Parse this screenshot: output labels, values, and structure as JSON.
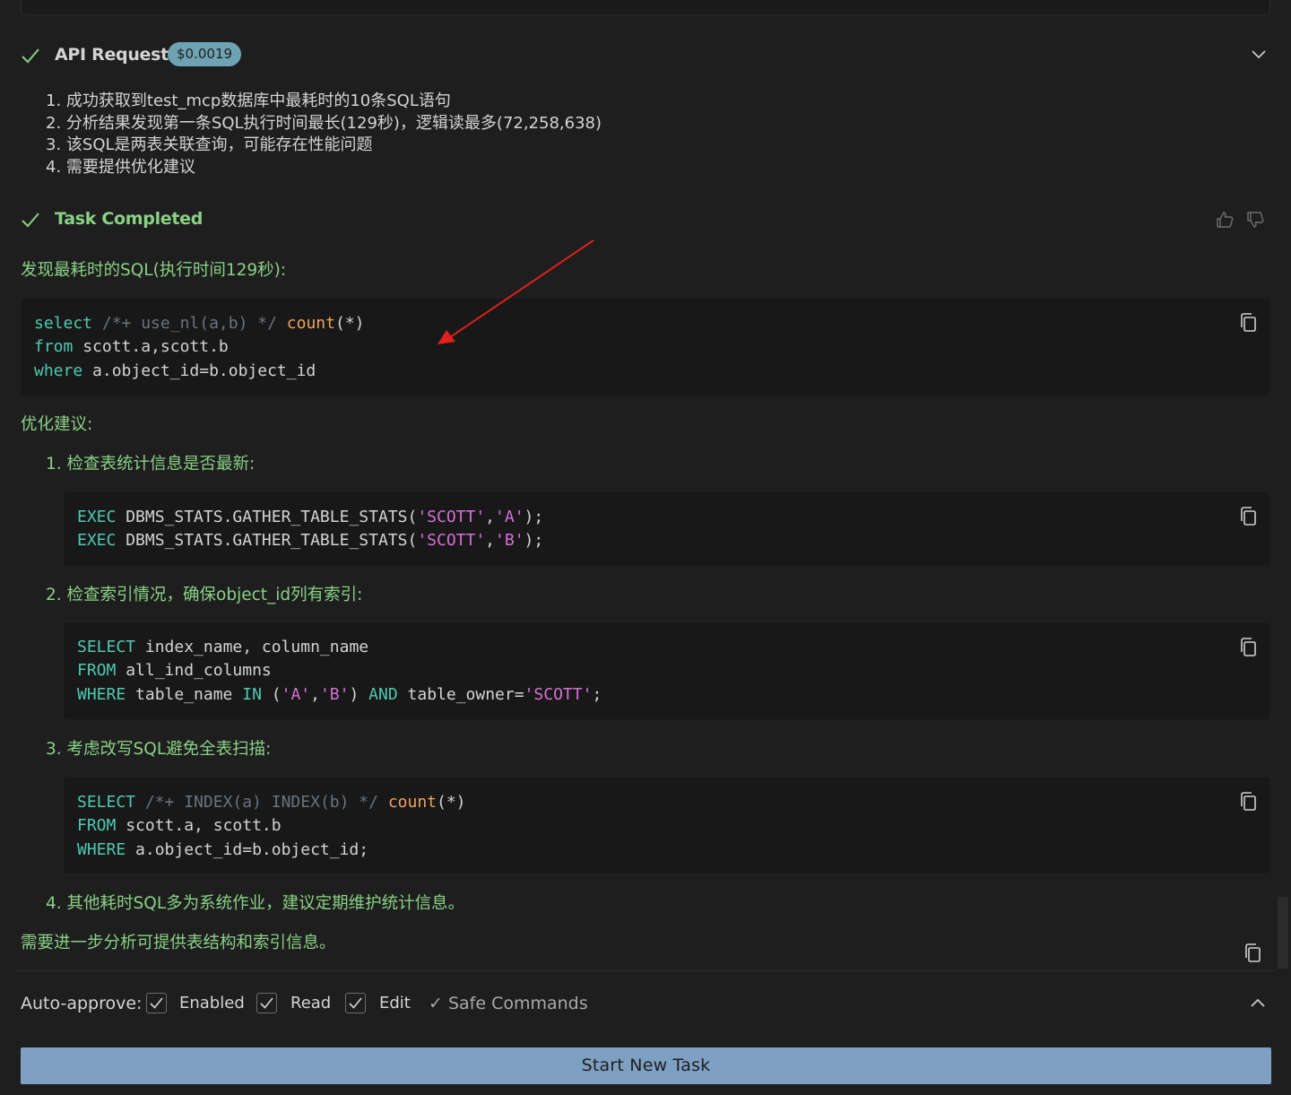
{
  "api_request": {
    "title": "API Request",
    "cost": "$0.0019",
    "items": [
      "1. 成功获取到test_mcp数据库中最耗时的10条SQL语句",
      "2. 分析结果发现第一条SQL执行时间最长(129秒)，逻辑读最多(72,258,638)",
      "3. 该SQL是两表关联查询，可能存在性能问题",
      "4. 需要提供优化建议"
    ]
  },
  "task": {
    "title": "Task Completed",
    "finding": "发现最耗时的SQL(执行时间129秒):",
    "code1": {
      "l1_kw": "select",
      "l1_cm": "/*+ use_nl(a,b) */",
      "l1_fn": "count",
      "l1_rest": "(*)",
      "l2_kw": "from",
      "l2_rest": " scott.a,scott.b",
      "l3_kw": "where",
      "l3_rest": " a.object_id=b.object_id"
    },
    "suggest_title": "优化建议:",
    "steps": [
      "1. 检查表统计信息是否最新:",
      "2. 检查索引情况，确保object_id列有索引:",
      "3. 考虑改写SQL避免全表扫描:",
      "4. 其他耗时SQL多为系统作业，建议定期维护统计信息。"
    ],
    "code2": {
      "kw": "EXEC",
      "call": " DBMS_STATS.GATHER_TABLE_STATS(",
      "s1": "'SCOTT'",
      "comma": ",",
      "sA": "'A'",
      "sB": "'B'",
      "end": ");"
    },
    "code3": {
      "l1_kw": "SELECT",
      "l1_rest": " index_name, column_name",
      "l2_kw": "FROM",
      "l2_rest": " all_ind_columns",
      "l3_kw": "WHERE",
      "l3_a": " table_name ",
      "l3_in": "IN",
      "l3_b": " (",
      "l3_sA": "'A'",
      "l3_c": ",",
      "l3_sB": "'B'",
      "l3_d": ") ",
      "l3_and": "AND",
      "l3_e": " table_owner=",
      "l3_sS": "'SCOTT'",
      "l3_f": ";"
    },
    "code4": {
      "l1_kw": "SELECT",
      "l1_cm": "/*+ INDEX(a) INDEX(b) */",
      "l1_fn": "count",
      "l1_rest": "(*)",
      "l2_kw": "FROM",
      "l2_rest": " scott.a, scott.b",
      "l3_kw": "WHERE",
      "l3_rest": " a.object_id=b.object_id;"
    },
    "footer_note": "需要进一步分析可提供表结构和索引信息。"
  },
  "auto_approve": {
    "label": "Auto-approve:",
    "options": [
      {
        "label": "Enabled",
        "checked": true
      },
      {
        "label": "Read",
        "checked": true
      },
      {
        "label": "Edit",
        "checked": true
      }
    ],
    "safe_commands": "✓ Safe Commands"
  },
  "start_button": "Start New Task",
  "colors": {
    "accent_green": "#89d185",
    "badge": "#6ea3b4",
    "button": "#7ea0c2",
    "annotation_arrow": "#e0201c"
  }
}
